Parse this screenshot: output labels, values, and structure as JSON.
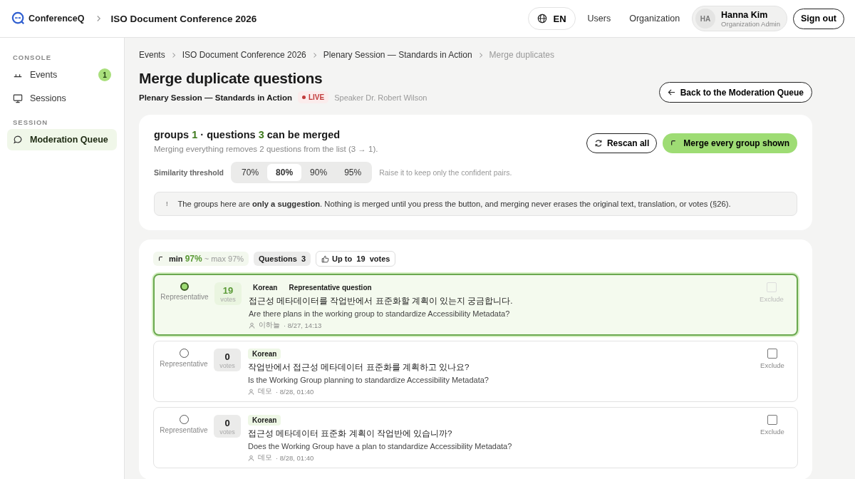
{
  "header": {
    "brand": "ConferenceQ",
    "event": "ISO Document Conference 2026",
    "language": "EN",
    "nav": [
      "Users",
      "Organization"
    ],
    "user": {
      "initials": "HA",
      "name": "Hanna Kim",
      "role": "Organization Admin"
    },
    "sign_out": "Sign out"
  },
  "sidebar": [
    {
      "heading": "CONSOLE",
      "items": [
        {
          "label": "Events",
          "kind": "events",
          "badge": "1",
          "selected": false
        },
        {
          "label": "Sessions",
          "kind": "monitor",
          "selected": false
        }
      ]
    },
    {
      "heading": "SESSION",
      "items": [
        {
          "label": "Moderation Queue",
          "kind": "chat",
          "selected": true
        }
      ]
    }
  ],
  "breadcrumbs": [
    {
      "label": "Events",
      "current": false
    },
    {
      "label": "ISO Document Conference 2026",
      "current": false
    },
    {
      "label": "Plenary Session — Standards in Action",
      "current": false
    },
    {
      "label": "Merge duplicates",
      "current": true
    }
  ],
  "page": {
    "title": "Merge duplicate questions",
    "session": "Plenary Session — Standards in Action",
    "live": "LIVE",
    "speaker": "Speaker Dr. Robert Wilson",
    "back": "Back to the Moderation Queue"
  },
  "summary": {
    "title": [
      {
        "text": "groups ",
        "kind": "plain"
      },
      {
        "text": "1",
        "kind": "count"
      },
      {
        "text": " · questions ",
        "kind": "plain"
      },
      {
        "text": "3",
        "kind": "count"
      },
      {
        "text": " can be merged",
        "kind": "plain"
      }
    ],
    "description": "Merging everything removes 2 questions from the list (3 → 1).",
    "rescan": "Rescan all",
    "merge_all": "Merge every group shown",
    "threshold_label": "Similarity threshold",
    "thresholds": [
      {
        "label": "70%",
        "selected": false
      },
      {
        "label": "80%",
        "selected": true
      },
      {
        "label": "90%",
        "selected": false
      },
      {
        "label": "95%",
        "selected": false
      }
    ],
    "threshold_hint": "Raise it to keep only the confident pairs.",
    "notice_icon": "!",
    "notice": "The groups here are **only a suggestion**. Nothing is merged until you press the button, and merging never erases the original text, translation, or votes (§26)."
  },
  "group": {
    "similarity": {
      "min_label": "min",
      "min": "97%",
      "max": "~ max 97%"
    },
    "questions_chip": {
      "label": "Questions",
      "count": "3"
    },
    "votes_chip": {
      "prefix": "Up to",
      "count": "19",
      "suffix": "votes"
    },
    "questions": [
      {
        "selected": true,
        "radio_label": "Representative",
        "votes": "19",
        "votes_label": "votes",
        "tags": [
          {
            "label": "Korean",
            "kind": "language"
          },
          {
            "label": "Representative question",
            "kind": "representative"
          }
        ],
        "text": "접근성 메타데이터를 작업반에서 표준화할 계획이 있는지 궁금합니다.",
        "translation": "Are there plans in the working group to standardize Accessibility Metadata?",
        "author": "이하늘",
        "time": "· 8/27, 14:13",
        "excluded": false,
        "exclude_disabled": true,
        "exclude_label": "Exclude"
      },
      {
        "selected": false,
        "radio_label": "Representative",
        "votes": "0",
        "votes_label": "votes",
        "tags": [
          {
            "label": "Korean",
            "kind": "language"
          }
        ],
        "text": "작업반에서 접근성 메타데이터 표준화를 계획하고 있나요?",
        "translation": "Is the Working Group planning to standardize Accessibility Metadata?",
        "author": "데모",
        "time": "· 8/28, 01:40",
        "excluded": false,
        "exclude_disabled": false,
        "exclude_label": "Exclude"
      },
      {
        "selected": false,
        "radio_label": "Representative",
        "votes": "0",
        "votes_label": "votes",
        "tags": [
          {
            "label": "Korean",
            "kind": "language"
          }
        ],
        "text": "접근성 메타데이터 표준화 계획이 작업반에 있습니까?",
        "translation": "Does the Working Group have a plan to standardize Accessibility Metadata?",
        "author": "데모",
        "time": "· 8/28, 01:40",
        "excluded": false,
        "exclude_disabled": false,
        "exclude_label": "Exclude"
      }
    ]
  }
}
